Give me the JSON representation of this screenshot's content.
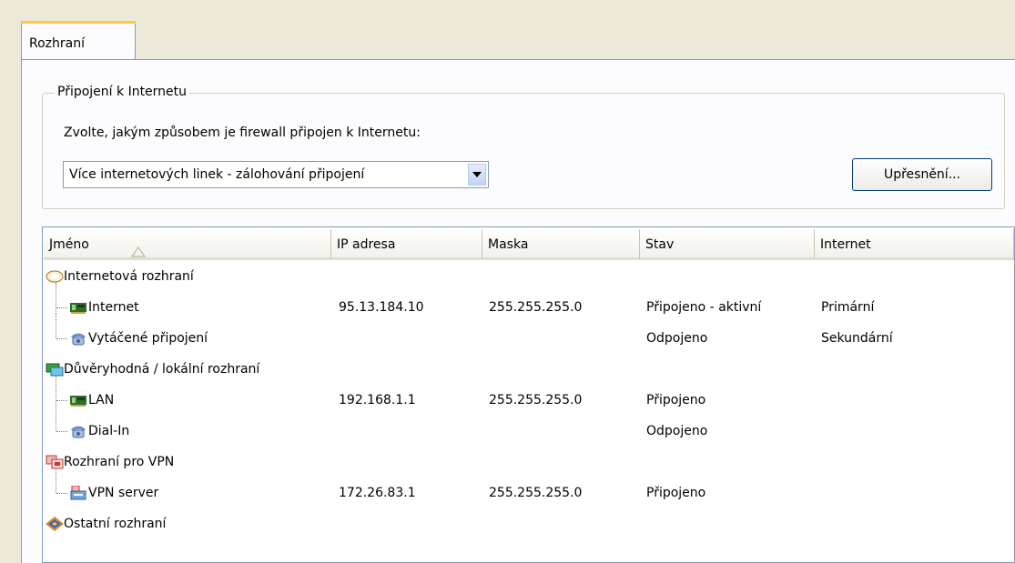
{
  "tabs": [
    {
      "label": "Rozhraní"
    }
  ],
  "internet_group": {
    "legend": "Připojení k Internetu",
    "prompt": "Zvolte, jakým způsobem je firewall připojen k Internetu:",
    "connection_select": {
      "value": "Více internetových linek - zálohování připojení"
    },
    "advanced_button": "Upřesnění..."
  },
  "table": {
    "columns": [
      "Jméno",
      "IP adresa",
      "Maska",
      "Stav",
      "Internet"
    ],
    "sort_column": "Jméno",
    "groups": [
      {
        "name": "Internetová rozhraní",
        "icon": "cloud-icon",
        "items": [
          {
            "name": "Internet",
            "icon": "network-card-icon",
            "ip": "95.13.184.10",
            "mask": "255.255.255.0",
            "status": "Připojeno - aktivní",
            "internet": "Primární"
          },
          {
            "name": "Vytáčené připojení",
            "icon": "dialup-icon",
            "ip": "",
            "mask": "",
            "status": "Odpojeno",
            "internet": "Sekundární"
          }
        ]
      },
      {
        "name": "Důvěryhodná / lokální rozhraní",
        "icon": "trusted-network-icon",
        "items": [
          {
            "name": "LAN",
            "icon": "network-card-icon",
            "ip": "192.168.1.1",
            "mask": "255.255.255.0",
            "status": "Připojeno",
            "internet": ""
          },
          {
            "name": "Dial-In",
            "icon": "dialup-icon",
            "ip": "",
            "mask": "",
            "status": "Odpojeno",
            "internet": ""
          }
        ]
      },
      {
        "name": "Rozhraní pro VPN",
        "icon": "vpn-icon",
        "items": [
          {
            "name": "VPN server",
            "icon": "vpn-server-icon",
            "ip": "172.26.83.1",
            "mask": "255.255.255.0",
            "status": "Připojeno",
            "internet": ""
          }
        ]
      },
      {
        "name": "Ostatní rozhraní",
        "icon": "other-interfaces-icon",
        "items": []
      }
    ]
  },
  "colors": {
    "background": "#ECE9D8",
    "panel": "#FCFCFE",
    "select_border": "#7F9DB9",
    "button_border": "#003C74"
  }
}
